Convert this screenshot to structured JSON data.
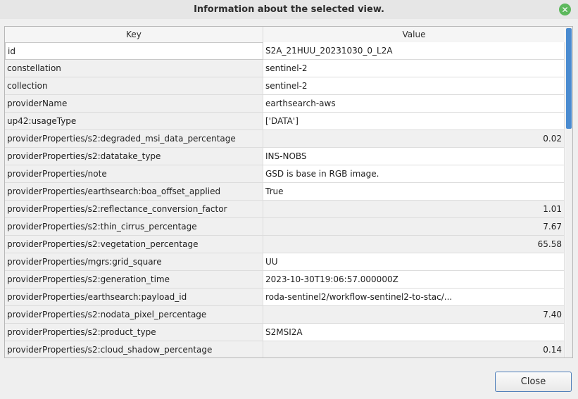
{
  "dialog": {
    "title": "Information about the selected view.",
    "close_icon": "close-icon",
    "close_button_label": "Close"
  },
  "table": {
    "headers": {
      "key": "Key",
      "value": "Value"
    },
    "rows": [
      {
        "key": "id",
        "value": "S2A_21HUU_20231030_0_L2A",
        "numeric": false
      },
      {
        "key": "constellation",
        "value": "sentinel-2",
        "numeric": false
      },
      {
        "key": "collection",
        "value": "sentinel-2",
        "numeric": false
      },
      {
        "key": "providerName",
        "value": "earthsearch-aws",
        "numeric": false
      },
      {
        "key": "up42:usageType",
        "value": "['DATA']",
        "numeric": false
      },
      {
        "key": "providerProperties/s2:degraded_msi_data_percentage",
        "value": "0.02",
        "numeric": true
      },
      {
        "key": "providerProperties/s2:datatake_type",
        "value": "INS-NOBS",
        "numeric": false
      },
      {
        "key": "providerProperties/note",
        "value": "GSD is base in RGB image.",
        "numeric": false
      },
      {
        "key": "providerProperties/earthsearch:boa_offset_applied",
        "value": "True",
        "numeric": false
      },
      {
        "key": "providerProperties/s2:reflectance_conversion_factor",
        "value": "1.01",
        "numeric": true
      },
      {
        "key": "providerProperties/s2:thin_cirrus_percentage",
        "value": "7.67",
        "numeric": true
      },
      {
        "key": "providerProperties/s2:vegetation_percentage",
        "value": "65.58",
        "numeric": true
      },
      {
        "key": "providerProperties/mgrs:grid_square",
        "value": "UU",
        "numeric": false
      },
      {
        "key": "providerProperties/s2:generation_time",
        "value": "2023-10-30T19:06:57.000000Z",
        "numeric": false
      },
      {
        "key": "providerProperties/earthsearch:payload_id",
        "value": "roda-sentinel2/workflow-sentinel2-to-stac/...",
        "numeric": false
      },
      {
        "key": "providerProperties/s2:nodata_pixel_percentage",
        "value": "7.40",
        "numeric": true
      },
      {
        "key": "providerProperties/s2:product_type",
        "value": "S2MSI2A",
        "numeric": false
      },
      {
        "key": "providerProperties/s2:cloud_shadow_percentage",
        "value": "0.14",
        "numeric": true
      }
    ]
  }
}
